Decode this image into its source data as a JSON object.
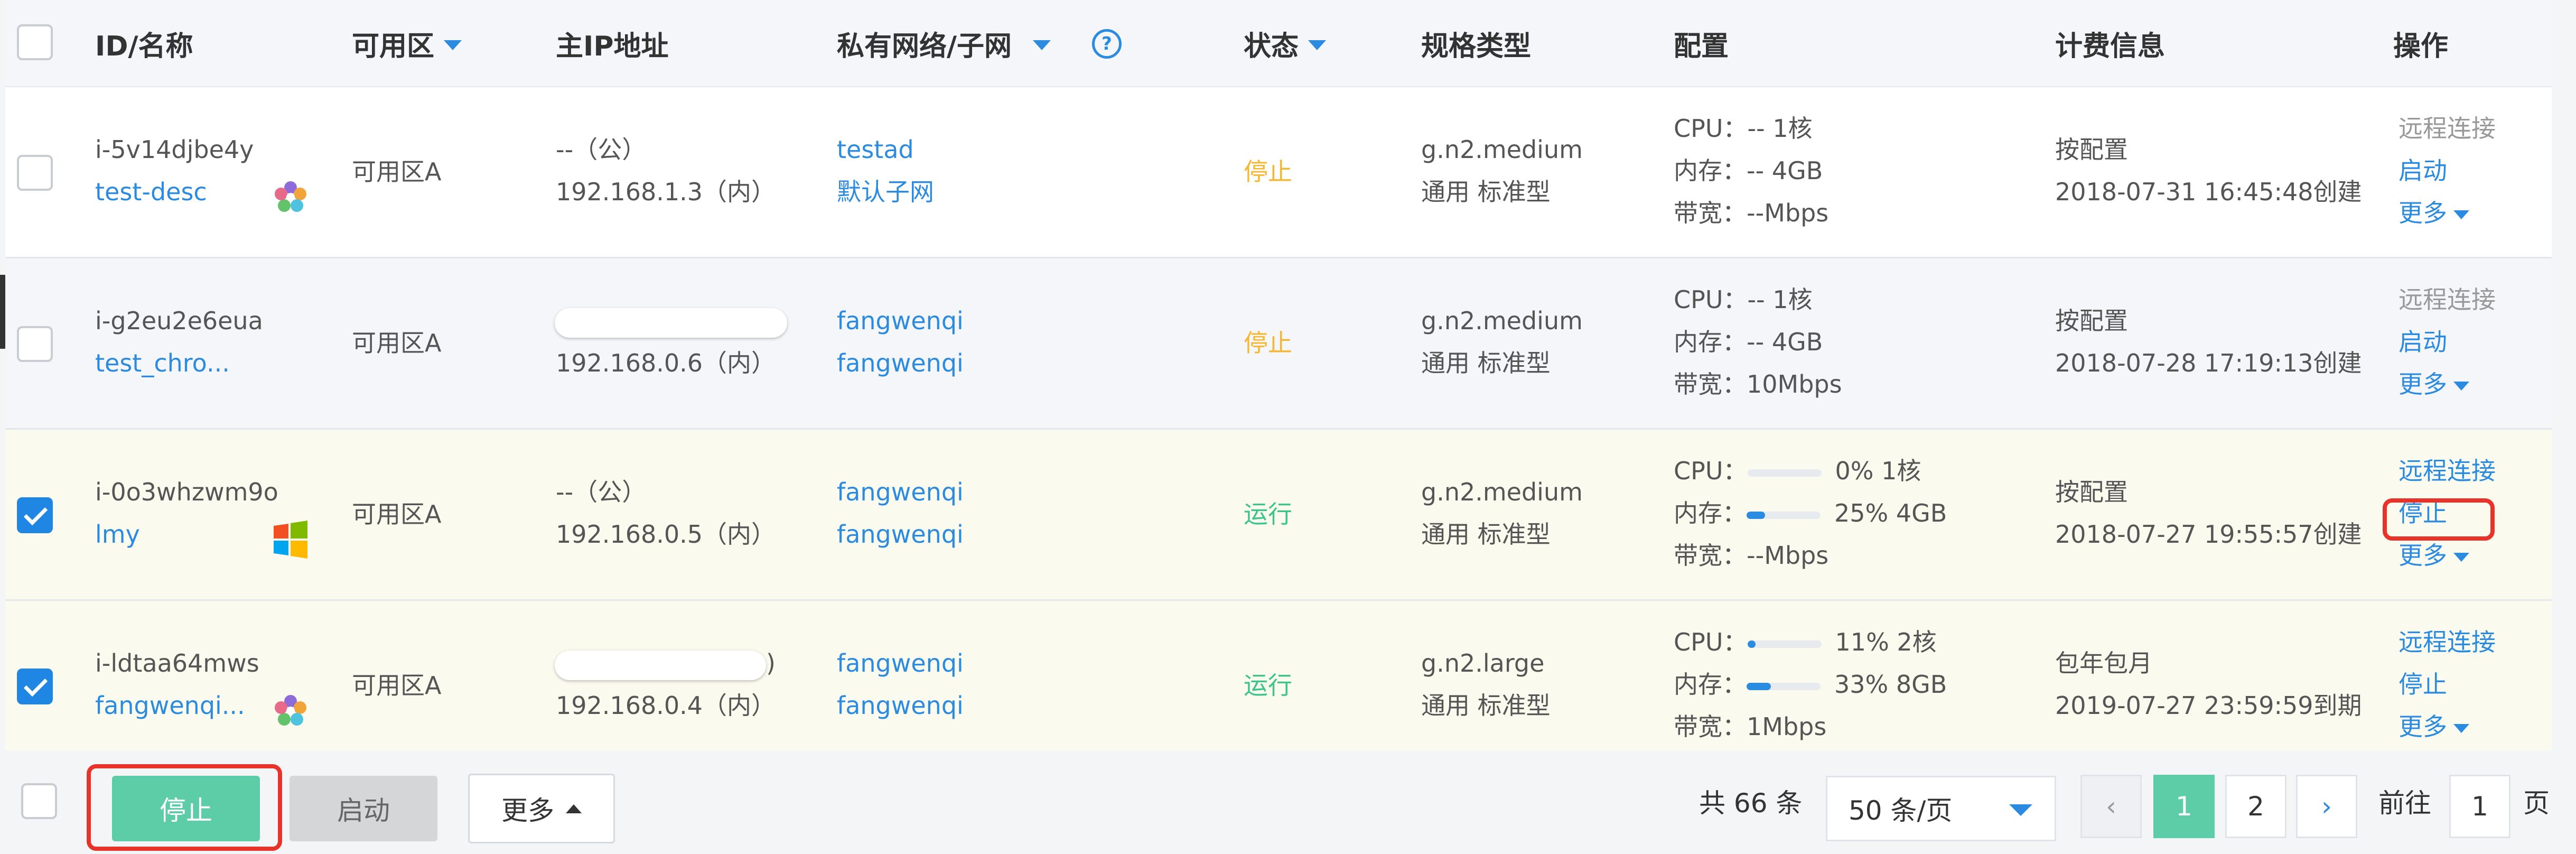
{
  "header": {
    "id_name": "ID/名称",
    "zone": "可用区",
    "main_ip": "主IP地址",
    "vpc_subnet": "私有网络/子网",
    "help": "?",
    "status": "状态",
    "spec_type": "规格类型",
    "config": "配置",
    "billing": "计费信息",
    "actions": "操作"
  },
  "config_labels": {
    "cpu": "CPU：",
    "mem": "内存：",
    "bw": "带宽："
  },
  "rows": [
    {
      "checked": false,
      "id": "i-5v14djbe4y",
      "name": "test-desc",
      "os_icon": "linux-flower-icon",
      "zone": "可用区A",
      "ip_public": "--（公）",
      "ip_private": "192.168.1.3（内）",
      "vpc": "testad",
      "subnet": "默认子网",
      "status": "停止",
      "status_color": "#f5b630",
      "spec": "g.n2.medium",
      "spec_type": "通用 标准型",
      "cpu": "--  1核",
      "mem": "--  4GB",
      "bw": "--Mbps",
      "billing_mode": "按配置",
      "billing_time": "2018-07-31 16:45:48创建",
      "action1": "远程连接",
      "action2": "启动",
      "action3": "更多"
    },
    {
      "checked": false,
      "id": "i-g2eu2e6eua",
      "name": "test_chro...",
      "zone": "可用区A",
      "ip_private": "192.168.0.6（内）",
      "vpc": "fangwenqi",
      "subnet": "fangwenqi",
      "status": "停止",
      "status_color": "#f5b630",
      "spec": "g.n2.medium",
      "spec_type": "通用 标准型",
      "cpu": "--  1核",
      "mem": "--  4GB",
      "bw": "10Mbps",
      "billing_mode": "按配置",
      "billing_time": "2018-07-28 17:19:13创建",
      "action1": "远程连接",
      "action2": "启动",
      "action3": "更多"
    },
    {
      "checked": true,
      "id": "i-0o3whzwm9o",
      "name": "lmy",
      "os_icon": "windows-icon",
      "zone": "可用区A",
      "ip_public": "--（公）",
      "ip_private": "192.168.0.5（内）",
      "vpc": "fangwenqi",
      "subnet": "fangwenqi",
      "status": "运行",
      "status_color": "#3cc48c",
      "spec": "g.n2.medium",
      "spec_type": "通用 标准型",
      "cpu_pct": 0,
      "cpu": "0%  1核",
      "mem_pct": 25,
      "mem": "25%  4GB",
      "bw": "--Mbps",
      "billing_mode": "按配置",
      "billing_time": "2018-07-27 19:55:57创建",
      "action1": "远程连接",
      "action2": "停止",
      "action3": "更多"
    },
    {
      "checked": true,
      "id": "i-ldtaa64mws",
      "name": "fangwenqi...",
      "os_icon": "linux-flower-icon",
      "zone": "可用区A",
      "ip_public_suffix": ")",
      "ip_private": "192.168.0.4（内）",
      "vpc": "fangwenqi",
      "subnet": "fangwenqi",
      "status": "运行",
      "status_color": "#3cc48c",
      "spec": "g.n2.large",
      "spec_type": "通用 标准型",
      "cpu_pct": 11,
      "cpu": "11%  2核",
      "mem_pct": 33,
      "mem": "33%  8GB",
      "bw": "1Mbps",
      "billing_mode": "包年包月",
      "billing_time": "2019-07-27 23:59:59到期",
      "action1": "远程连接",
      "action2": "停止",
      "action3": "更多"
    }
  ],
  "footer": {
    "stop_label": "停止",
    "start_label": "启动",
    "more_label": "更多",
    "total": "共 66 条",
    "page_size": "50 条/页",
    "prev": "‹",
    "page1": "1",
    "page2": "2",
    "next": "›",
    "goto_label": "前往",
    "goto_value": "1",
    "page_unit": "页"
  },
  "colors": {
    "accent": "#2b8be0",
    "stop_button": "#5ccda6",
    "highlight": "#e8332a"
  }
}
